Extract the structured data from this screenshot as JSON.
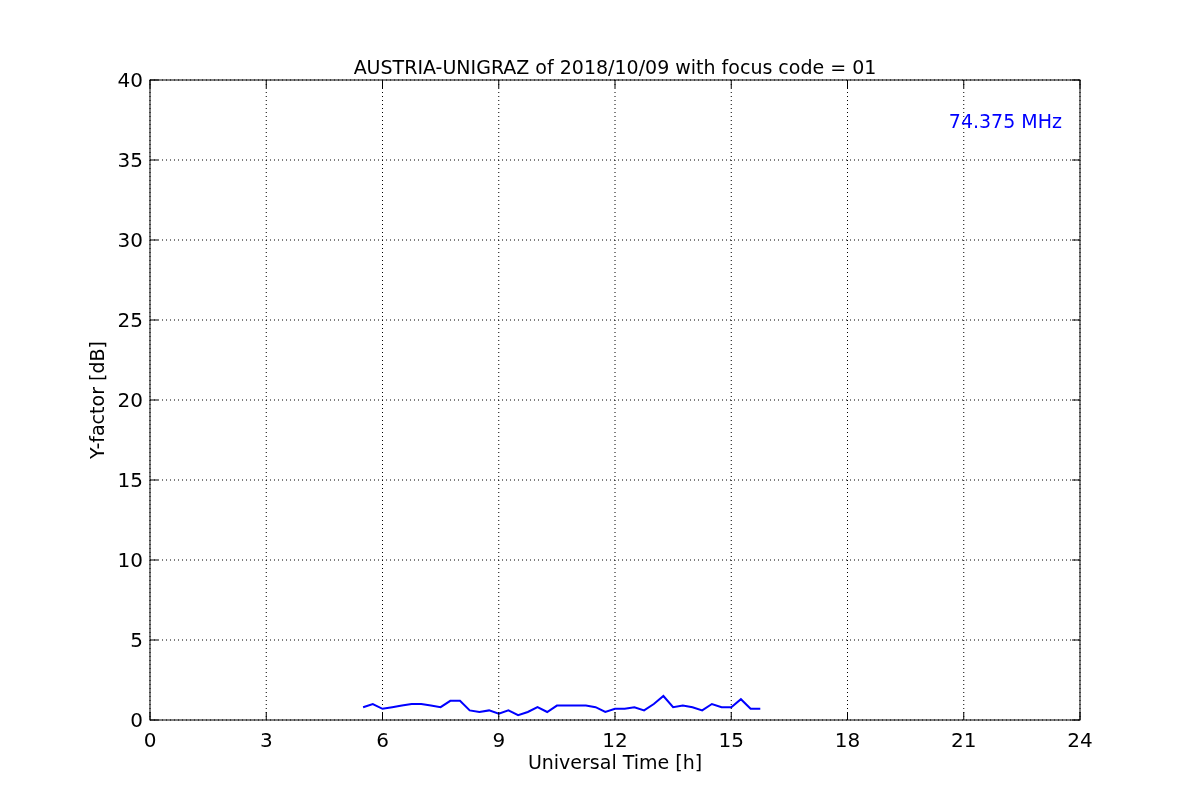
{
  "chart_data": {
    "type": "line",
    "title": "AUSTRIA-UNIGRAZ of 2018/10/09 with focus code = 01",
    "xlabel": "Universal Time [h]",
    "ylabel": "Y-factor [dB]",
    "x": [
      5.5,
      5.75,
      6.0,
      6.25,
      6.5,
      6.75,
      7.0,
      7.25,
      7.5,
      7.75,
      8.0,
      8.25,
      8.5,
      8.75,
      9.0,
      9.25,
      9.5,
      9.75,
      10.0,
      10.25,
      10.5,
      10.75,
      11.0,
      11.25,
      11.5,
      11.75,
      12.0,
      12.25,
      12.5,
      12.75,
      13.0,
      13.25,
      13.5,
      13.75,
      14.0,
      14.25,
      14.5,
      14.75,
      15.0,
      15.25,
      15.5,
      15.75
    ],
    "series": [
      {
        "color": "#0000ff",
        "values": [
          0.8,
          1.0,
          0.7,
          0.8,
          0.9,
          1.0,
          1.0,
          0.9,
          0.8,
          1.2,
          1.2,
          0.6,
          0.5,
          0.6,
          0.4,
          0.6,
          0.3,
          0.5,
          0.8,
          0.5,
          0.9,
          0.9,
          0.9,
          0.9,
          0.8,
          0.5,
          0.7,
          0.7,
          0.8,
          0.6,
          1.0,
          1.5,
          0.8,
          0.9,
          0.8,
          0.6,
          1.0,
          0.8,
          0.8,
          1.3,
          0.7,
          0.7
        ]
      }
    ],
    "xlim": [
      0,
      24
    ],
    "ylim": [
      0,
      40
    ],
    "xticks": [
      0,
      3,
      6,
      9,
      12,
      15,
      18,
      21,
      24
    ],
    "yticks": [
      0,
      5,
      10,
      15,
      20,
      25,
      30,
      35,
      40
    ],
    "grid": true,
    "annotations": [
      "74.375 MHz"
    ]
  }
}
